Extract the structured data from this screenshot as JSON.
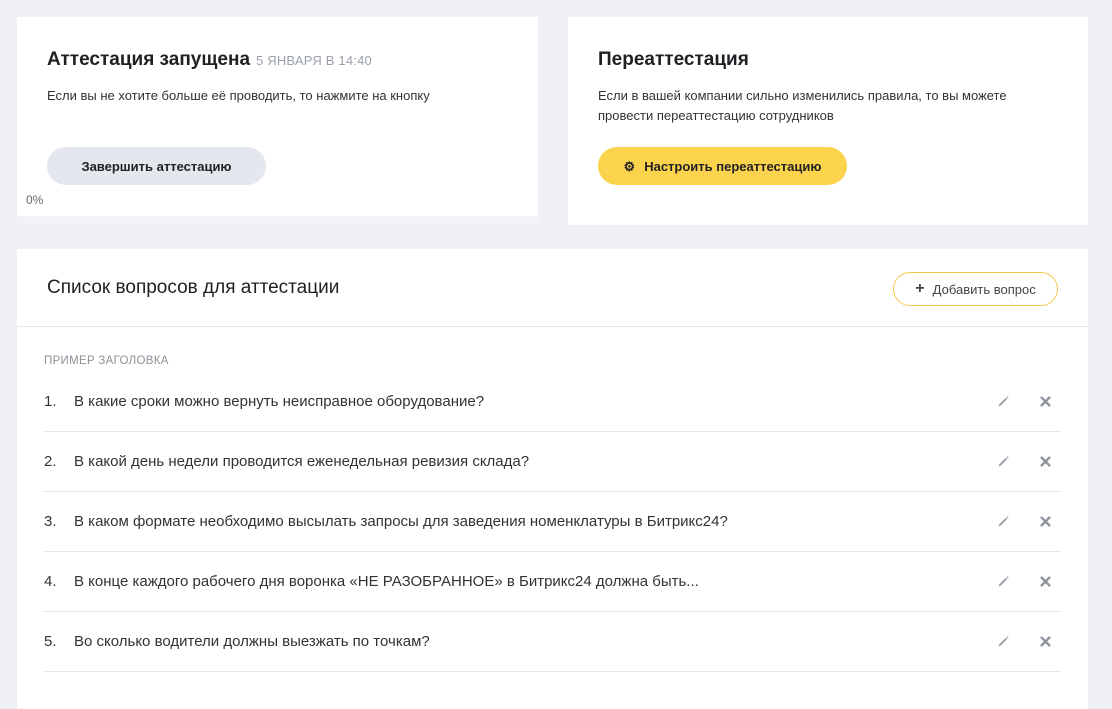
{
  "attestation": {
    "title": "Аттестация запущена",
    "started_at": "5 ЯНВАРЯ В 14:40",
    "description": "Если вы не хотите больше её проводить, то нажмите на кнопку",
    "finish_button": "Завершить аттестацию",
    "progress_label": "0%",
    "progress_value": 0
  },
  "reattestation": {
    "title": "Переаттестация",
    "description_line1": "Если в вашей компании сильно изменились правила, то вы можете",
    "description_line2": "провести переаттестацию сотрудников",
    "configure_button": "Настроить переаттестацию",
    "configure_icon": "gear-icon"
  },
  "questions": {
    "title": "Список вопросов для аттестации",
    "add_button": "Добавить вопрос",
    "add_icon": "plus-icon",
    "section_label": "ПРИМЕР ЗАГОЛОВКА",
    "items": [
      {
        "num": "1.",
        "text": "В какие сроки можно вернуть неисправное оборудование?"
      },
      {
        "num": "2.",
        "text": "В какой день недели проводится еженедельная ревизия склада?"
      },
      {
        "num": "3.",
        "text": "В каком формате необходимо высылать запросы для заведения номенклатуры в Битрикс24?"
      },
      {
        "num": "4.",
        "text": "В конце каждого рабочего дня воронка «НЕ РАЗОБРАННОЕ» в Битрикс24 должна быть..."
      },
      {
        "num": "5.",
        "text": "Во сколько водители должны выезжать по точкам?"
      }
    ],
    "row_icons": [
      "pencil-icon",
      "close-icon"
    ]
  },
  "colors": {
    "accent_yellow": "#fcd34d",
    "add_border": "#f4c84a",
    "page_bg": "#eef0f4",
    "grey_button": "#e4e7ee"
  }
}
